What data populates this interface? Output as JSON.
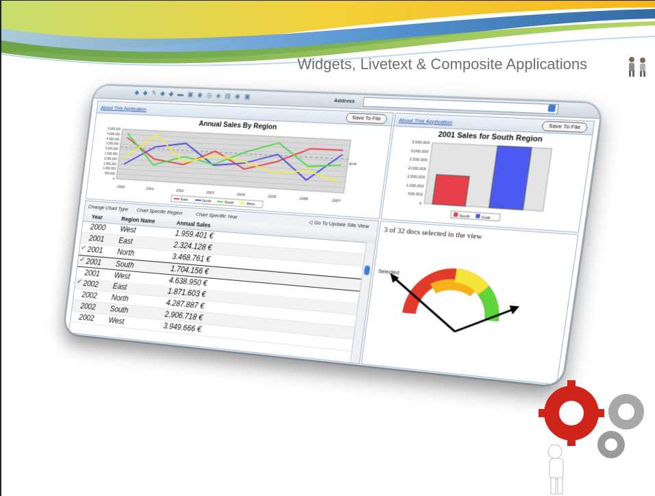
{
  "slide": {
    "title": "Widgets, Livetext & Composite Applications"
  },
  "colors": {
    "swoosh_green": "#8bbf3c",
    "swoosh_yellow": "#f2c418",
    "swoosh_blue": "#2a6fb0",
    "gear_red": "#d0241b",
    "gear_grey": "#9c9c9c"
  },
  "browser": {
    "address_label": "Address"
  },
  "left_panel": {
    "about_label": "About This Application",
    "save_label": "Save To File"
  },
  "right_panel": {
    "about_label": "About This Application",
    "save_label": "Save To File"
  },
  "grid": {
    "toolbar": {
      "change_chart_type": "Change Chart Type",
      "specific_region": "Chart Specific Region",
      "specific_year": "Chart Specific Year",
      "update_view": "Go To Update Site View"
    },
    "columns": {
      "year": "Year",
      "region": "Region Name",
      "sales": "Annual Sales"
    },
    "rows": [
      {
        "check": "",
        "year": "2000",
        "region": "West",
        "sales": "1.959.401 €"
      },
      {
        "check": "",
        "year": "2001",
        "region": "East",
        "sales": "2.324.128 €"
      },
      {
        "check": "✓",
        "year": "2001",
        "region": "North",
        "sales": "3.468.761 €"
      },
      {
        "check": "✓",
        "year": "2001",
        "region": "South",
        "sales": "1.704.156 €"
      },
      {
        "check": "",
        "year": "2001",
        "region": "West",
        "sales": "4.638.950 €"
      },
      {
        "check": "✓",
        "year": "2002",
        "region": "East",
        "sales": "1.871.603 €"
      },
      {
        "check": "",
        "year": "2002",
        "region": "North",
        "sales": "4.287.887 €"
      },
      {
        "check": "",
        "year": "2002",
        "region": "South",
        "sales": "2.906.718 €"
      },
      {
        "check": "",
        "year": "2002",
        "region": "West",
        "sales": "3.949.666 €"
      }
    ]
  },
  "gauge": {
    "docs_text": "3 of 32 docs selected in the view",
    "selected_label": "Selected"
  },
  "chart_data": [
    {
      "type": "line",
      "title": "Annual Sales By Region",
      "x": [
        "2000",
        "2001",
        "2002",
        "2003",
        "2004",
        "2005",
        "2006",
        "2007"
      ],
      "ylim": [
        0,
        5000000
      ],
      "yticks": [
        "5,000,000",
        "4,500,000",
        "4,000,000",
        "3,500,000",
        "3,000,000",
        "2,500,000",
        "2,000,000",
        "1,500,000",
        "1,000,000",
        "500,000",
        "0"
      ],
      "goal_label": "goal",
      "goal_value": 3200000,
      "series": [
        {
          "name": "East",
          "color": "#e8404a",
          "values": [
            4200000,
            2200000,
            1800000,
            3300000,
            1700000,
            2600000,
            4000000,
            4000000
          ]
        },
        {
          "name": "North",
          "color": "#4a4ae0",
          "values": [
            1500000,
            3400000,
            3900000,
            1900000,
            2300000,
            3300000,
            1000000,
            3600000
          ]
        },
        {
          "name": "South",
          "color": "#52d84a",
          "values": [
            4600000,
            1600000,
            2600000,
            2000000,
            3400000,
            4400000,
            2300000,
            2600000
          ]
        },
        {
          "name": "West",
          "color": "#f4ee3a",
          "values": [
            2200000,
            4600000,
            2000000,
            2900000,
            2400000,
            1500000,
            1900000,
            1000000
          ]
        }
      ],
      "grid": true,
      "legend": "bottom"
    },
    {
      "type": "bar",
      "title": "2001 Sales for South Region",
      "categories": [
        "South",
        "Goal"
      ],
      "values": [
        1700000,
        3500000
      ],
      "colors": [
        "#e8404a",
        "#4a5af0"
      ],
      "ylim": [
        0,
        3500000
      ],
      "yticks": [
        "3,500,000",
        "3,000,000",
        "2,500,000",
        "2,000,000",
        "1,500,000",
        "1,000,000",
        "500,000",
        "0"
      ],
      "legend": "bottom"
    }
  ]
}
